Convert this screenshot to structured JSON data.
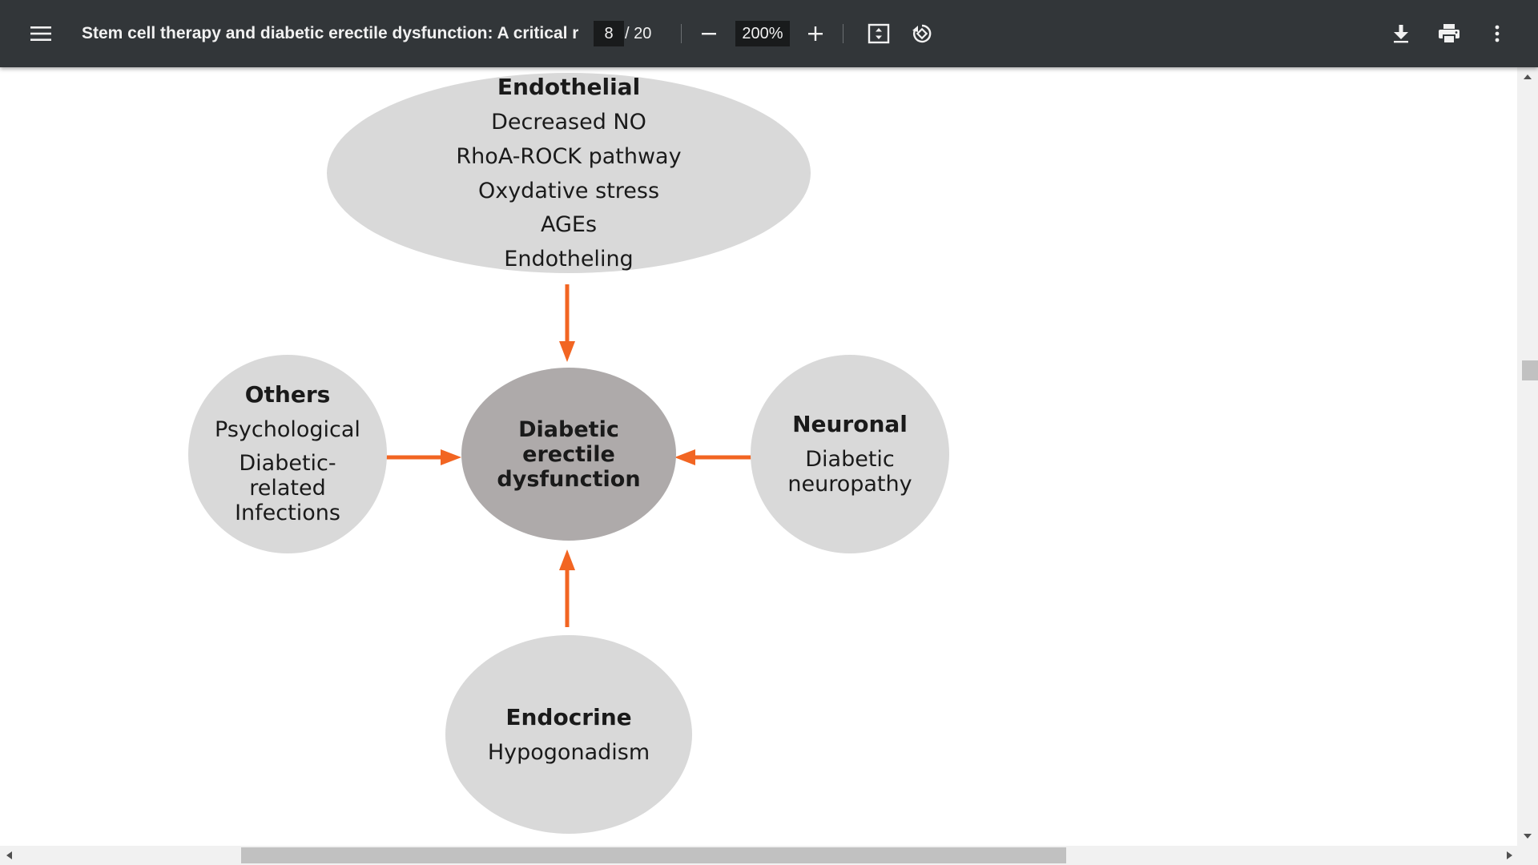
{
  "toolbar": {
    "menu_icon": "hamburger-menu-icon",
    "title": "Stem cell therapy and diabetic erectile dysfunction: A critical re...",
    "page_current": "8",
    "page_total": "/ 20",
    "zoom_value": "200%",
    "zoom_out_icon": "minus-icon",
    "zoom_in_icon": "plus-icon",
    "fit_icon": "fit-to-page-icon",
    "rotate_icon": "rotate-counterclockwise-icon",
    "download_icon": "download-icon",
    "print_icon": "print-icon",
    "more_icon": "more-vertical-icon"
  },
  "diagram": {
    "endothelial": {
      "title": "Endothelial",
      "items": [
        "Decreased NO",
        "RhoA-ROCK pathway",
        "Oxydative stress",
        "AGEs",
        "Endotheling"
      ]
    },
    "center": {
      "lines": [
        "Diabetic",
        "erectile",
        "dysfunction"
      ]
    },
    "others": {
      "title": "Others",
      "item1": "Psychological",
      "item2_lines": [
        "Diabetic-",
        "related",
        "Infections"
      ]
    },
    "neuronal": {
      "title": "Neuronal",
      "item_lines": [
        "Diabetic",
        "neuropathy"
      ]
    },
    "endocrine": {
      "title": "Endocrine",
      "item": "Hypogonadism"
    },
    "colors": {
      "node_fill": "#d9d9d9",
      "center_fill": "#aeaaaa",
      "arrow": "#f26522"
    }
  },
  "colors": {
    "toolbar_bg": "#323639",
    "toolbar_text": "#f1f1f1"
  }
}
